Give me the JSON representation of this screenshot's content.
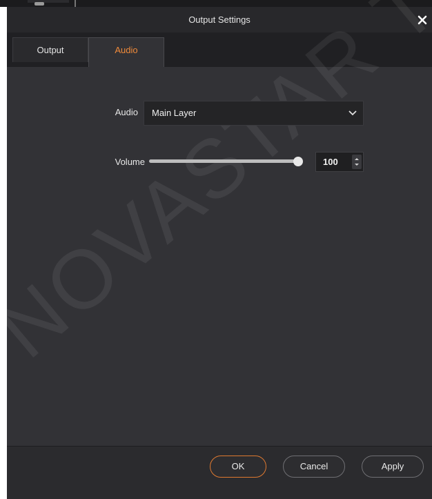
{
  "dialog": {
    "title": "Output Settings"
  },
  "tabs": [
    {
      "label": "Output",
      "active": false
    },
    {
      "label": "Audio",
      "active": true
    }
  ],
  "audio": {
    "label": "Audio",
    "selected": "Main Layer"
  },
  "volume": {
    "label": "Volume",
    "value": "100",
    "level_fraction": 1.0
  },
  "buttons": {
    "ok": "OK",
    "cancel": "Cancel",
    "apply": "Apply"
  },
  "watermark": "NOVASTAR TECH",
  "colors": {
    "accent": "#f08a3a",
    "background": "#323236",
    "titlebar": "#28282b"
  }
}
